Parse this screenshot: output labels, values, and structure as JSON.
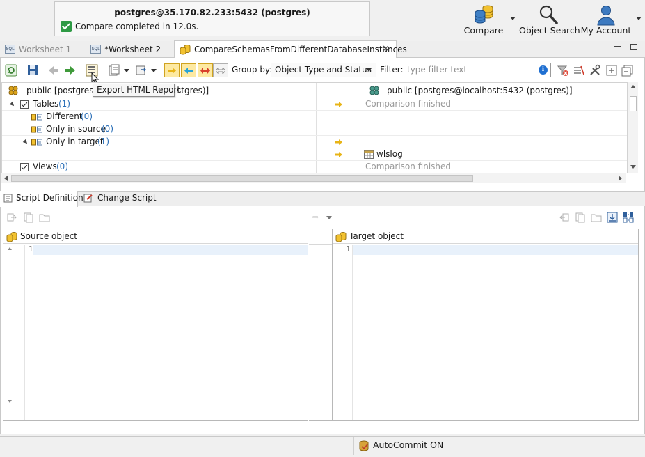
{
  "notification": {
    "title": "postgres@35.170.82.233:5432 (postgres)",
    "message": "Compare completed in 12.0s."
  },
  "top_actions": {
    "compare": "Compare",
    "object_search": "Object Search",
    "my_account": "My Account"
  },
  "editor_tabs": [
    {
      "label": "Worksheet 1",
      "active": false
    },
    {
      "label": "*Worksheet 2",
      "active": false
    },
    {
      "label": "CompareSchemasFromDifferentDatabaseInstances",
      "active": true
    }
  ],
  "toolbar": {
    "group_by_label": "Group by:",
    "group_by_value": "Object Type and Status",
    "filter_label": "Filter:",
    "filter_placeholder": "type filter text",
    "tooltip": "Export HTML Report"
  },
  "tree": {
    "source_header": "public [postgres@35.170.82.233:5432 (postgres)]",
    "source_header_visible_start": "public [postgres@",
    "source_header_visible_end": "stgres)]",
    "target_header": "public [postgres@localhost:5432 (postgres)]",
    "rows": [
      {
        "label": "Tables",
        "count": "(1)",
        "target": "Comparison finished"
      },
      {
        "label": "Different",
        "count": "(0)",
        "target": ""
      },
      {
        "label": "Only in source",
        "count": "(0)",
        "target": ""
      },
      {
        "label": "Only in target",
        "count": "(1)",
        "target": ""
      },
      {
        "label": "",
        "count": "",
        "target": "wlslog"
      },
      {
        "label": "Views",
        "count": "(0)",
        "target": "Comparison finished"
      }
    ]
  },
  "bottom_tabs": [
    {
      "label": "Script Definition",
      "active": true
    },
    {
      "label": "Change Script",
      "active": false
    }
  ],
  "panes": {
    "source_title": "Source object",
    "target_title": "Target object",
    "source_line": "1",
    "target_line": "1"
  },
  "status": {
    "autocommit": "AutoCommit ON"
  }
}
